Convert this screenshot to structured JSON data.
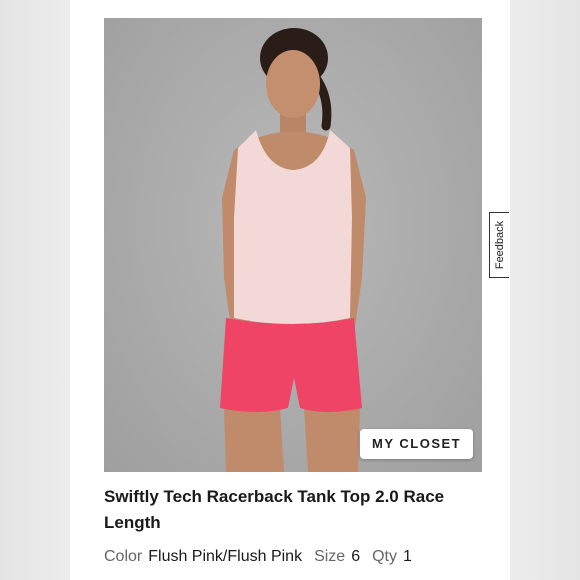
{
  "product": {
    "title": "Swiftly Tech Racerback Tank Top 2.0 Race Length",
    "color_label": "Color",
    "color_value": "Flush Pink/Flush Pink",
    "size_label": "Size",
    "size_value": "6",
    "qty_label": "Qty",
    "qty_value": "1"
  },
  "overlay": {
    "closet_button": "MY CLOSET",
    "feedback_tab": "Feedback"
  },
  "colors": {
    "tank": "#f2d8d6",
    "shorts": "#ef4466",
    "background": "#ababab"
  }
}
